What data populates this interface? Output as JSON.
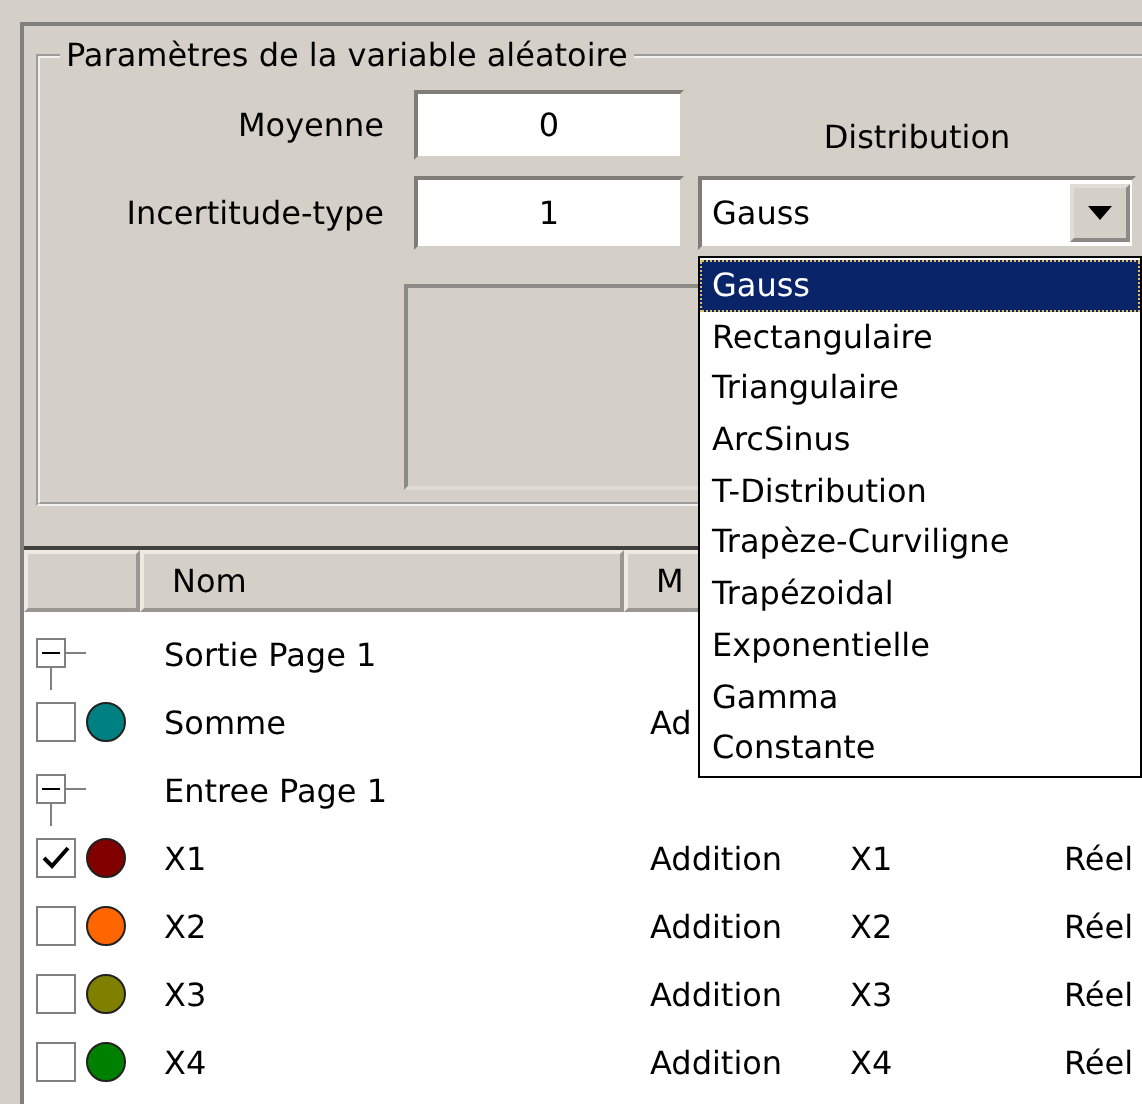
{
  "group": {
    "title": "Paramètres de la variable aléatoire",
    "fields": [
      {
        "label": "Moyenne",
        "value": "0"
      },
      {
        "label": "Incertitude-type",
        "value": "1"
      }
    ],
    "distribution": {
      "label": "Distribution",
      "value": "Gauss",
      "options": [
        {
          "label": "Gauss",
          "selected": true
        },
        {
          "label": "Rectangulaire",
          "selected": false
        },
        {
          "label": "Triangulaire",
          "selected": false
        },
        {
          "label": "ArcSinus",
          "selected": false
        },
        {
          "label": "T-Distribution",
          "selected": false
        },
        {
          "label": "Trapèze-Curviligne",
          "selected": false
        },
        {
          "label": "Trapézoidal",
          "selected": false
        },
        {
          "label": "Exponentielle",
          "selected": false
        },
        {
          "label": "Gamma",
          "selected": false
        },
        {
          "label": "Constante",
          "selected": false
        }
      ]
    }
  },
  "table": {
    "columns": [
      "Nom",
      "M"
    ],
    "rows": [
      {
        "kind": "group",
        "name": "Sortie Page 1",
        "expanded": true
      },
      {
        "kind": "item",
        "checked": false,
        "color": "#008080",
        "name": "Somme",
        "method": "Ad"
      },
      {
        "kind": "group",
        "name": "Entree Page 1",
        "expanded": true
      },
      {
        "kind": "item",
        "checked": true,
        "color": "#800000",
        "name": "X1",
        "method": "Addition",
        "column_3": "X1",
        "type": "Réel"
      },
      {
        "kind": "item",
        "checked": false,
        "color": "#ff6600",
        "name": "X2",
        "method": "Addition",
        "column_3": "X2",
        "type": "Réel"
      },
      {
        "kind": "item",
        "checked": false,
        "color": "#808000",
        "name": "X3",
        "method": "Addition",
        "column_3": "X3",
        "type": "Réel"
      },
      {
        "kind": "item",
        "checked": false,
        "color": "#008000",
        "name": "X4",
        "method": "Addition",
        "column_3": "X4",
        "type": "Réel"
      }
    ]
  }
}
